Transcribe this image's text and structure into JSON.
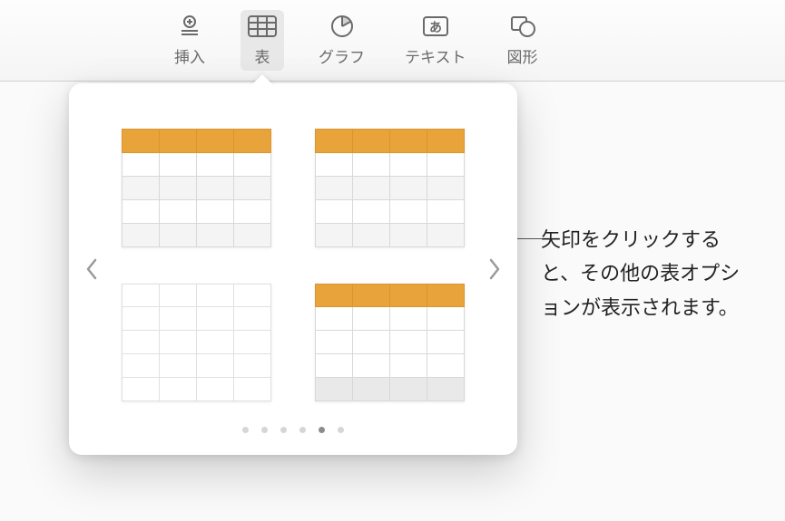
{
  "toolbar": {
    "insert": {
      "label": "挿入",
      "icon": "insert-icon"
    },
    "table": {
      "label": "表",
      "icon": "table-icon"
    },
    "chart": {
      "label": "グラフ",
      "icon": "chart-icon"
    },
    "text": {
      "label": "テキスト",
      "icon": "text-icon"
    },
    "shape": {
      "label": "図形",
      "icon": "shape-icon"
    }
  },
  "popover": {
    "thumbs": [
      {
        "id": "header-column-alt",
        "name": "table-style-1"
      },
      {
        "id": "header-alt",
        "name": "table-style-2"
      },
      {
        "id": "plain",
        "name": "table-style-3"
      },
      {
        "id": "header-column-footer",
        "name": "table-style-4"
      }
    ],
    "page_dots": 6,
    "active_dot": 4
  },
  "callout": {
    "text": "矢印をクリックすると、その他の表オプションが表示されます。"
  }
}
